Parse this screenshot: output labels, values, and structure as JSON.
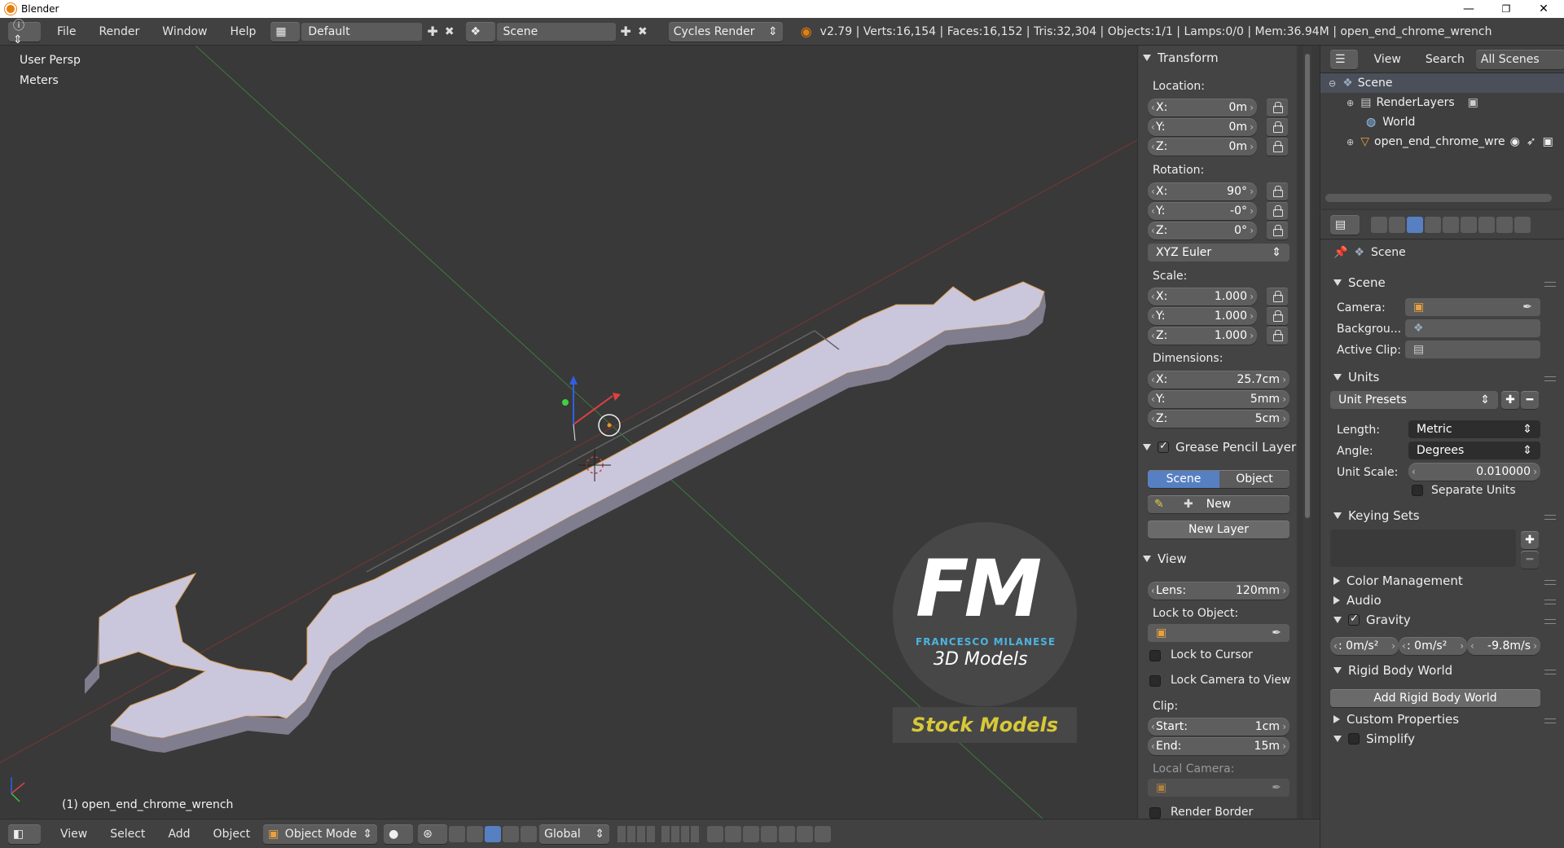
{
  "window": {
    "title": "Blender",
    "minimize": "—",
    "maximize": "❐",
    "close": "✕"
  },
  "menu": {
    "file": "File",
    "render": "Render",
    "window": "Window",
    "help": "Help"
  },
  "layout": {
    "name": "Default"
  },
  "scene": {
    "name": "Scene"
  },
  "engine": {
    "name": "Cycles Render"
  },
  "stats": "v2.79 | Verts:16,154 | Faces:16,152 | Tris:32,304 | Objects:1/1 | Lamps:0/0 | Mem:36.94M | open_end_chrome_wrench",
  "viewport": {
    "view_name": "User Persp",
    "units": "Meters",
    "object_label": "(1) open_end_chrome_wrench"
  },
  "watermark": {
    "initials": "FM",
    "author": "FRANCESCO MILANESE",
    "subtitle": "3D Models",
    "banner": "Stock Models"
  },
  "npanel": {
    "transform": {
      "header": "Transform",
      "location_label": "Location:",
      "location": [
        {
          "axis": "X:",
          "value": "0m"
        },
        {
          "axis": "Y:",
          "value": "0m"
        },
        {
          "axis": "Z:",
          "value": "0m"
        }
      ],
      "rotation_label": "Rotation:",
      "rotation": [
        {
          "axis": "X:",
          "value": "90°"
        },
        {
          "axis": "Y:",
          "value": "-0°"
        },
        {
          "axis": "Z:",
          "value": "0°"
        }
      ],
      "rotation_mode": "XYZ Euler",
      "scale_label": "Scale:",
      "scale": [
        {
          "axis": "X:",
          "value": "1.000"
        },
        {
          "axis": "Y:",
          "value": "1.000"
        },
        {
          "axis": "Z:",
          "value": "1.000"
        }
      ],
      "dimensions_label": "Dimensions:",
      "dimensions": [
        {
          "axis": "X:",
          "value": "25.7cm"
        },
        {
          "axis": "Y:",
          "value": "5mm"
        },
        {
          "axis": "Z:",
          "value": "5cm"
        }
      ]
    },
    "grease": {
      "header": "Grease Pencil Layer",
      "scene_tab": "Scene",
      "object_tab": "Object",
      "new": "New",
      "new_layer": "New Layer"
    },
    "view": {
      "header": "View",
      "lens_label": "Lens:",
      "lens": "120mm",
      "lock_object_label": "Lock to Object:",
      "lock_cursor": "Lock to Cursor",
      "lock_camera": "Lock Camera to View",
      "clip_label": "Clip:",
      "start_label": "Start:",
      "start": "1cm",
      "end_label": "End:",
      "end": "15m",
      "local_camera": "Local Camera:",
      "render_border": "Render Border"
    }
  },
  "outliner": {
    "view": "View",
    "search": "Search",
    "filter": "All Scenes",
    "items": [
      {
        "label": "Scene"
      },
      {
        "label": "RenderLayers"
      },
      {
        "label": "World"
      },
      {
        "label": "open_end_chrome_wre"
      }
    ]
  },
  "properties": {
    "context": "Scene",
    "scene_panel": {
      "header": "Scene",
      "camera": "Camera:",
      "background": "Backgrou...",
      "active_clip": "Active Clip:"
    },
    "units": {
      "header": "Units",
      "presets": "Unit Presets",
      "length_label": "Length:",
      "length": "Metric",
      "angle_label": "Angle:",
      "angle": "Degrees",
      "scale_label": "Unit Scale:",
      "scale": "0.010000",
      "separate": "Separate Units"
    },
    "keying": {
      "header": "Keying Sets"
    },
    "color": {
      "header": "Color Management"
    },
    "audio": {
      "header": "Audio"
    },
    "gravity": {
      "header": "Gravity",
      "x": ": 0m/s²",
      "y": ": 0m/s²",
      "z": "-9.8m/s"
    },
    "rigid": {
      "header": "Rigid Body World",
      "add": "Add Rigid Body World"
    },
    "custom": {
      "header": "Custom Properties"
    },
    "simplify": {
      "header": "Simplify"
    }
  },
  "bottom": {
    "view": "View",
    "select": "Select",
    "add": "Add",
    "object": "Object",
    "mode": "Object Mode",
    "orientation": "Global"
  },
  "colors": {
    "accent": "#5680c2",
    "wrench": "#c9c6dc",
    "bg": "#393939"
  }
}
